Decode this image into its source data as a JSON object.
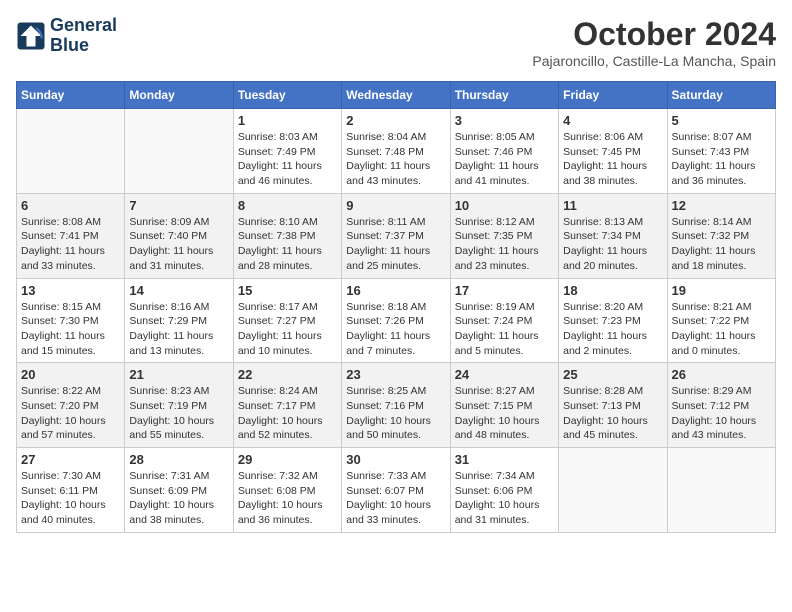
{
  "header": {
    "logo": {
      "line1": "General",
      "line2": "Blue"
    },
    "title": "October 2024",
    "location": "Pajaroncillo, Castille-La Mancha, Spain"
  },
  "weekdays": [
    "Sunday",
    "Monday",
    "Tuesday",
    "Wednesday",
    "Thursday",
    "Friday",
    "Saturday"
  ],
  "weeks": [
    [
      {
        "day": "",
        "info": ""
      },
      {
        "day": "",
        "info": ""
      },
      {
        "day": "1",
        "info": "Sunrise: 8:03 AM\nSunset: 7:49 PM\nDaylight: 11 hours and 46 minutes."
      },
      {
        "day": "2",
        "info": "Sunrise: 8:04 AM\nSunset: 7:48 PM\nDaylight: 11 hours and 43 minutes."
      },
      {
        "day": "3",
        "info": "Sunrise: 8:05 AM\nSunset: 7:46 PM\nDaylight: 11 hours and 41 minutes."
      },
      {
        "day": "4",
        "info": "Sunrise: 8:06 AM\nSunset: 7:45 PM\nDaylight: 11 hours and 38 minutes."
      },
      {
        "day": "5",
        "info": "Sunrise: 8:07 AM\nSunset: 7:43 PM\nDaylight: 11 hours and 36 minutes."
      }
    ],
    [
      {
        "day": "6",
        "info": "Sunrise: 8:08 AM\nSunset: 7:41 PM\nDaylight: 11 hours and 33 minutes."
      },
      {
        "day": "7",
        "info": "Sunrise: 8:09 AM\nSunset: 7:40 PM\nDaylight: 11 hours and 31 minutes."
      },
      {
        "day": "8",
        "info": "Sunrise: 8:10 AM\nSunset: 7:38 PM\nDaylight: 11 hours and 28 minutes."
      },
      {
        "day": "9",
        "info": "Sunrise: 8:11 AM\nSunset: 7:37 PM\nDaylight: 11 hours and 25 minutes."
      },
      {
        "day": "10",
        "info": "Sunrise: 8:12 AM\nSunset: 7:35 PM\nDaylight: 11 hours and 23 minutes."
      },
      {
        "day": "11",
        "info": "Sunrise: 8:13 AM\nSunset: 7:34 PM\nDaylight: 11 hours and 20 minutes."
      },
      {
        "day": "12",
        "info": "Sunrise: 8:14 AM\nSunset: 7:32 PM\nDaylight: 11 hours and 18 minutes."
      }
    ],
    [
      {
        "day": "13",
        "info": "Sunrise: 8:15 AM\nSunset: 7:30 PM\nDaylight: 11 hours and 15 minutes."
      },
      {
        "day": "14",
        "info": "Sunrise: 8:16 AM\nSunset: 7:29 PM\nDaylight: 11 hours and 13 minutes."
      },
      {
        "day": "15",
        "info": "Sunrise: 8:17 AM\nSunset: 7:27 PM\nDaylight: 11 hours and 10 minutes."
      },
      {
        "day": "16",
        "info": "Sunrise: 8:18 AM\nSunset: 7:26 PM\nDaylight: 11 hours and 7 minutes."
      },
      {
        "day": "17",
        "info": "Sunrise: 8:19 AM\nSunset: 7:24 PM\nDaylight: 11 hours and 5 minutes."
      },
      {
        "day": "18",
        "info": "Sunrise: 8:20 AM\nSunset: 7:23 PM\nDaylight: 11 hours and 2 minutes."
      },
      {
        "day": "19",
        "info": "Sunrise: 8:21 AM\nSunset: 7:22 PM\nDaylight: 11 hours and 0 minutes."
      }
    ],
    [
      {
        "day": "20",
        "info": "Sunrise: 8:22 AM\nSunset: 7:20 PM\nDaylight: 10 hours and 57 minutes."
      },
      {
        "day": "21",
        "info": "Sunrise: 8:23 AM\nSunset: 7:19 PM\nDaylight: 10 hours and 55 minutes."
      },
      {
        "day": "22",
        "info": "Sunrise: 8:24 AM\nSunset: 7:17 PM\nDaylight: 10 hours and 52 minutes."
      },
      {
        "day": "23",
        "info": "Sunrise: 8:25 AM\nSunset: 7:16 PM\nDaylight: 10 hours and 50 minutes."
      },
      {
        "day": "24",
        "info": "Sunrise: 8:27 AM\nSunset: 7:15 PM\nDaylight: 10 hours and 48 minutes."
      },
      {
        "day": "25",
        "info": "Sunrise: 8:28 AM\nSunset: 7:13 PM\nDaylight: 10 hours and 45 minutes."
      },
      {
        "day": "26",
        "info": "Sunrise: 8:29 AM\nSunset: 7:12 PM\nDaylight: 10 hours and 43 minutes."
      }
    ],
    [
      {
        "day": "27",
        "info": "Sunrise: 7:30 AM\nSunset: 6:11 PM\nDaylight: 10 hours and 40 minutes."
      },
      {
        "day": "28",
        "info": "Sunrise: 7:31 AM\nSunset: 6:09 PM\nDaylight: 10 hours and 38 minutes."
      },
      {
        "day": "29",
        "info": "Sunrise: 7:32 AM\nSunset: 6:08 PM\nDaylight: 10 hours and 36 minutes."
      },
      {
        "day": "30",
        "info": "Sunrise: 7:33 AM\nSunset: 6:07 PM\nDaylight: 10 hours and 33 minutes."
      },
      {
        "day": "31",
        "info": "Sunrise: 7:34 AM\nSunset: 6:06 PM\nDaylight: 10 hours and 31 minutes."
      },
      {
        "day": "",
        "info": ""
      },
      {
        "day": "",
        "info": ""
      }
    ]
  ]
}
